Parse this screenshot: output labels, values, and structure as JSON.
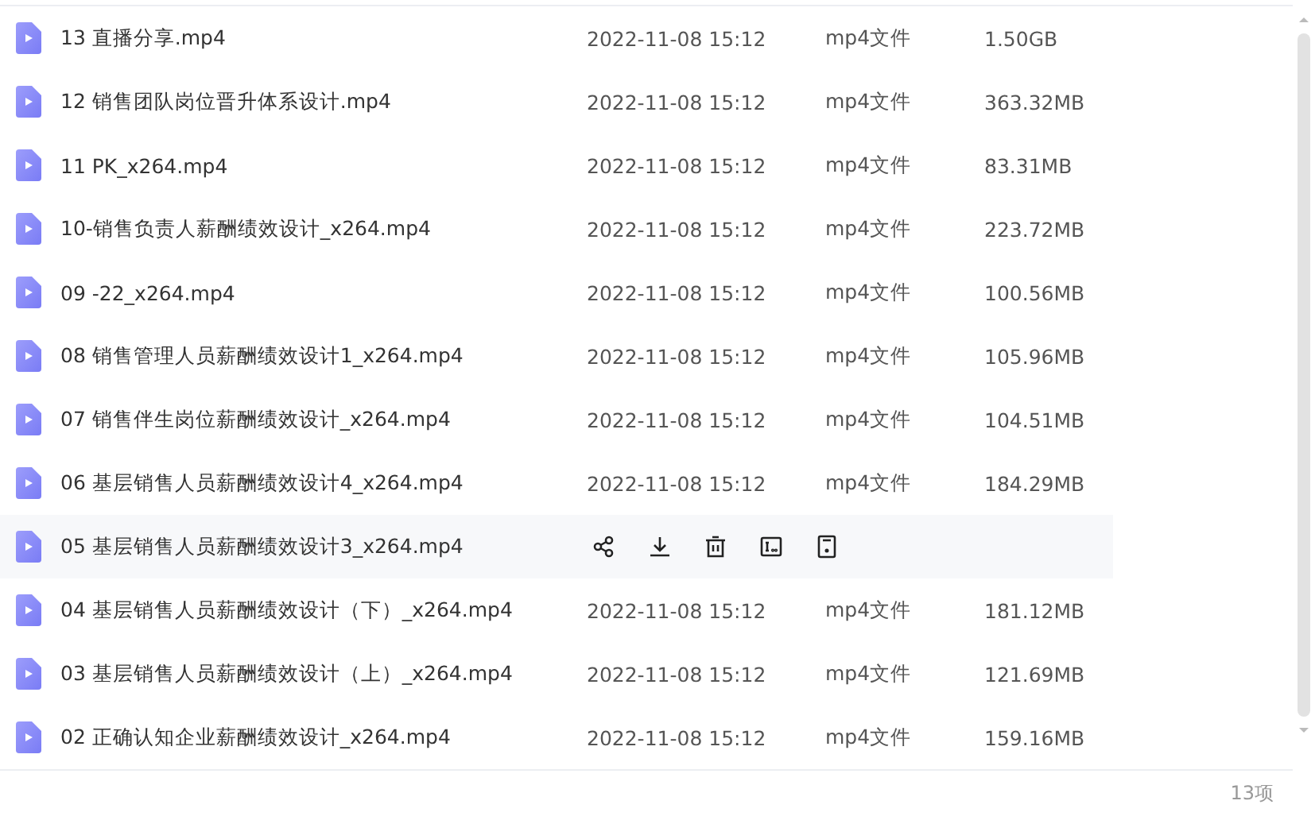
{
  "files": [
    {
      "name": "13 直播分享.mp4",
      "date": "2022-11-08 15:12",
      "type": "mp4文件",
      "size": "1.50GB",
      "hovered": false
    },
    {
      "name": "12 销售团队岗位晋升体系设计.mp4",
      "date": "2022-11-08 15:12",
      "type": "mp4文件",
      "size": "363.32MB",
      "hovered": false
    },
    {
      "name": "11 PK_x264.mp4",
      "date": "2022-11-08 15:12",
      "type": "mp4文件",
      "size": "83.31MB",
      "hovered": false
    },
    {
      "name": "10-销售负责人薪酬绩效设计_x264.mp4",
      "date": "2022-11-08 15:12",
      "type": "mp4文件",
      "size": "223.72MB",
      "hovered": false
    },
    {
      "name": "09 -22_x264.mp4",
      "date": "2022-11-08 15:12",
      "type": "mp4文件",
      "size": "100.56MB",
      "hovered": false
    },
    {
      "name": "08 销售管理人员薪酬绩效设计1_x264.mp4",
      "date": "2022-11-08 15:12",
      "type": "mp4文件",
      "size": "105.96MB",
      "hovered": false
    },
    {
      "name": "07 销售伴生岗位薪酬绩效设计_x264.mp4",
      "date": "2022-11-08 15:12",
      "type": "mp4文件",
      "size": "104.51MB",
      "hovered": false
    },
    {
      "name": "06 基层销售人员薪酬绩效设计4_x264.mp4",
      "date": "2022-11-08 15:12",
      "type": "mp4文件",
      "size": "184.29MB",
      "hovered": false
    },
    {
      "name": "05 基层销售人员薪酬绩效设计3_x264.mp4",
      "hovered": true
    },
    {
      "name": "04 基层销售人员薪酬绩效设计（下）_x264.mp4",
      "date": "2022-11-08 15:12",
      "type": "mp4文件",
      "size": "181.12MB",
      "hovered": false
    },
    {
      "name": "03 基层销售人员薪酬绩效设计（上）_x264.mp4",
      "date": "2022-11-08 15:12",
      "type": "mp4文件",
      "size": "121.69MB",
      "hovered": false
    },
    {
      "name": "02 正确认知企业薪酬绩效设计_x264.mp4",
      "date": "2022-11-08 15:12",
      "type": "mp4文件",
      "size": "159.16MB",
      "hovered": false
    }
  ],
  "footer": {
    "count": "13项"
  }
}
